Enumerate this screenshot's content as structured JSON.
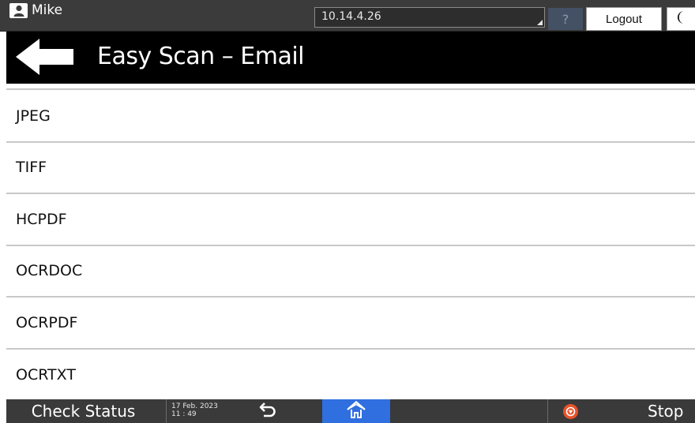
{
  "topbar": {
    "user_name": "Mike",
    "user_icon": "user-icon",
    "ip_address": "10.14.4.26",
    "help_label": "?",
    "logout_label": "Logout",
    "sleep_icon": "moon-icon"
  },
  "header": {
    "back_icon": "back-arrow-icon",
    "title": "Easy Scan – Email"
  },
  "list": {
    "items": [
      {
        "label": "JPEG"
      },
      {
        "label": "TIFF"
      },
      {
        "label": "HCPDF"
      },
      {
        "label": "OCRDOC"
      },
      {
        "label": "OCRPDF"
      },
      {
        "label": "OCRTXT"
      }
    ]
  },
  "bottombar": {
    "check_status_label": "Check Status",
    "date": "17 Feb. 2023",
    "time": "11 : 49",
    "return_icon": "return-icon",
    "home_icon": "home-icon",
    "stop_icon": "stop-icon",
    "stop_label": "Stop"
  },
  "colors": {
    "topbar_bg": "#3b3b3b",
    "titlebar_bg": "#000000",
    "home_accent": "#2f6fe0",
    "stop_accent": "#e8532a",
    "help_bg": "#445064"
  }
}
